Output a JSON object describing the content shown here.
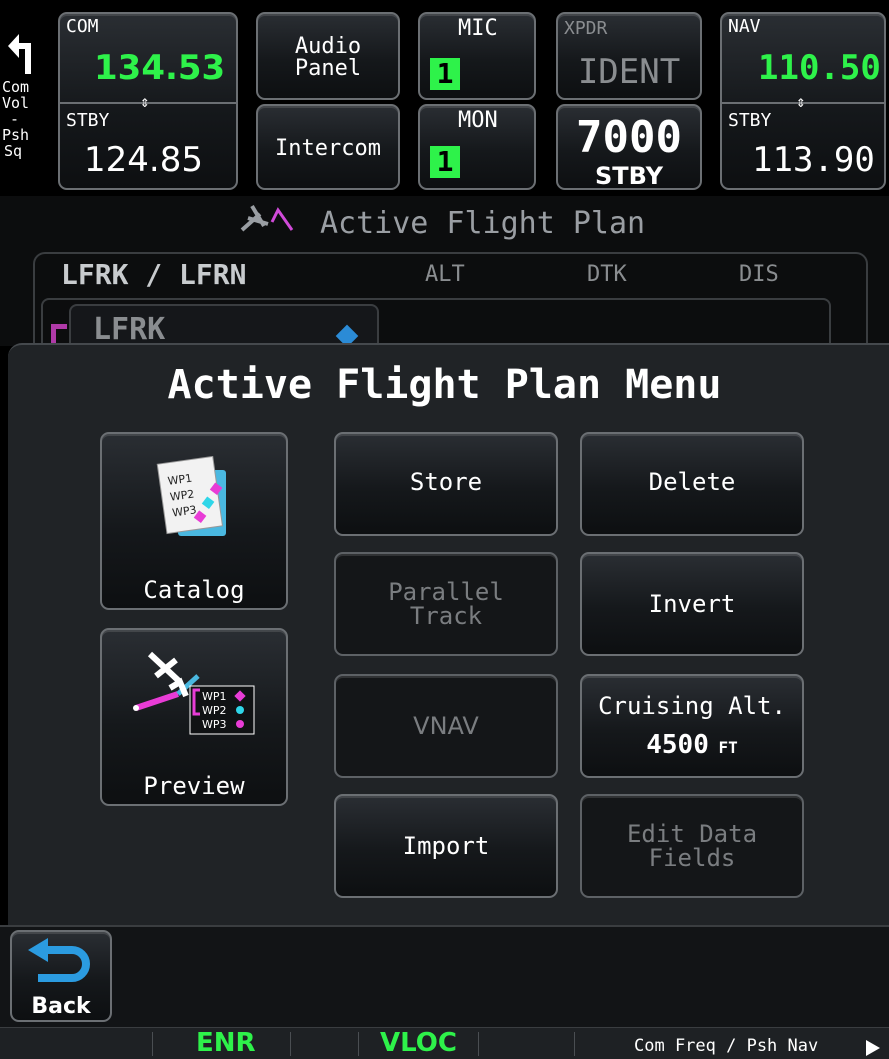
{
  "topbar": {
    "com_knob": {
      "l1": "Com",
      "l2": "Vol",
      "l3": "-",
      "l4": "Psh",
      "l5": "Sq"
    },
    "com": {
      "label": "COM",
      "active": "134.53",
      "stby_label": "STBY",
      "stby": "124.85",
      "swap": "⇕"
    },
    "audio": {
      "top": "Audio\nPanel",
      "bottom": "Intercom"
    },
    "mic": {
      "label": "MIC",
      "value": "1"
    },
    "mon": {
      "label": "MON",
      "value": "1"
    },
    "xpdr": {
      "label": "XPDR",
      "ident": "IDENT",
      "code": "7000",
      "mode": "STBY"
    },
    "nav": {
      "label": "NAV",
      "active": "110.50",
      "stby_label": "STBY",
      "stby": "113.90",
      "swap": "⇕"
    }
  },
  "flight_plan": {
    "title": "Active Flight Plan",
    "route": "LFRK / LFRN",
    "cols": [
      "ALT",
      "DTK",
      "DIS"
    ],
    "first_wpt": "LFRK"
  },
  "menu": {
    "title": "Active Flight Plan Menu",
    "catalog": "Catalog",
    "preview": "Preview",
    "store": "Store",
    "delete": "Delete",
    "parallel": "Parallel\nTrack",
    "invert": "Invert",
    "vnav": "VNAV",
    "cruise_label": "Cruising Alt.",
    "cruise_value": "4500",
    "cruise_unit": "FT",
    "import": "Import",
    "edit_fields": "Edit Data\nFields",
    "wp_labels": [
      "WP1",
      "WP2",
      "WP3"
    ]
  },
  "back": "Back",
  "status": {
    "enr": "ENR",
    "vloc": "VLOC",
    "hint": "Com Freq / Psh Nav"
  },
  "colors": {
    "green": "#2ef24a",
    "magenta": "#e83cd6",
    "cyan": "#2fd6e8"
  }
}
